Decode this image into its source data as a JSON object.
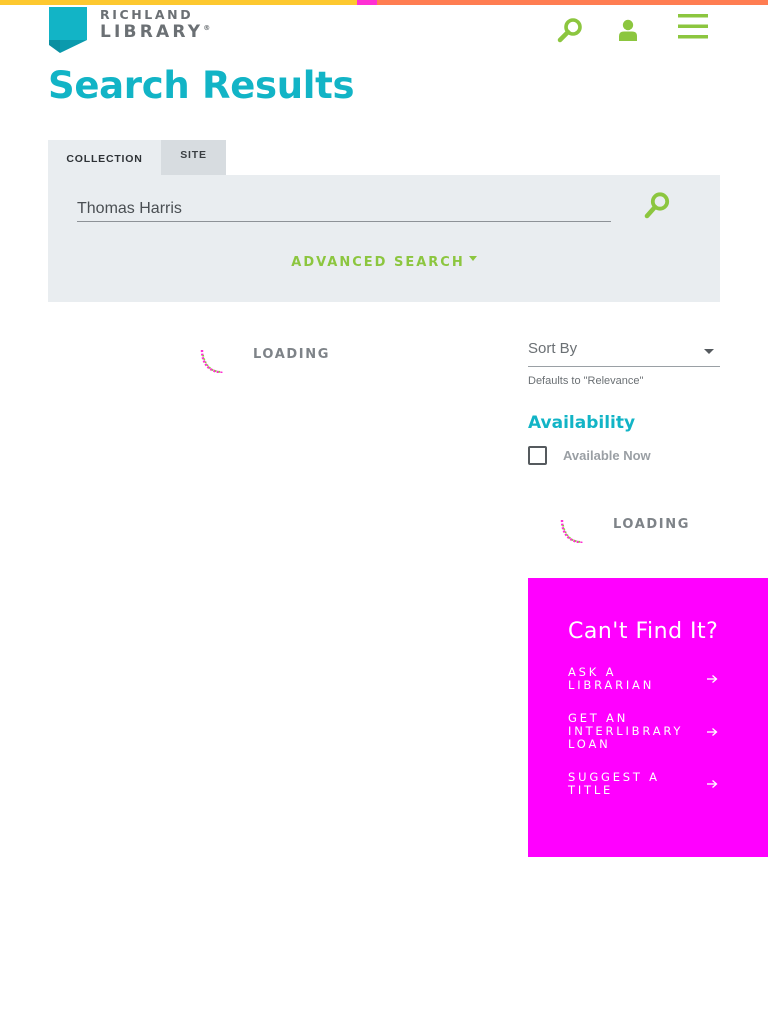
{
  "header": {
    "logo_line1": "RICHLAND",
    "logo_line2": "LIBRARY",
    "logo_reg": "®",
    "search_icon": "search-icon",
    "account_icon": "user-icon",
    "menu_icon": "hamburger-menu-icon"
  },
  "page": {
    "title": "Search Results"
  },
  "tabs": [
    {
      "label": "COLLECTION",
      "active": true
    },
    {
      "label": "SITE",
      "active": false
    }
  ],
  "search": {
    "value": "Thomas Harris",
    "advanced_label": "ADVANCED SEARCH"
  },
  "results": {
    "loading_text": "LOADING"
  },
  "sidebar": {
    "sort_label": "Sort By",
    "sort_hint": "Defaults to \"Relevance\"",
    "availability_title": "Availability",
    "availability_option": "Available Now",
    "loading_text": "LOADING"
  },
  "cant_find": {
    "title": "Can't Find It?",
    "links": [
      {
        "label": "ASK A LIBRARIAN"
      },
      {
        "label": "GET AN INTERLIBRARY LOAN"
      },
      {
        "label": "SUGGEST A TITLE"
      }
    ]
  },
  "colors": {
    "accent_teal": "#12b4c6",
    "accent_green": "#8cc63f",
    "magenta": "#ff00ff",
    "stripe_yellow": "#fdc82f",
    "stripe_pink": "#ff2fd4",
    "stripe_orange": "#ff7d52"
  }
}
